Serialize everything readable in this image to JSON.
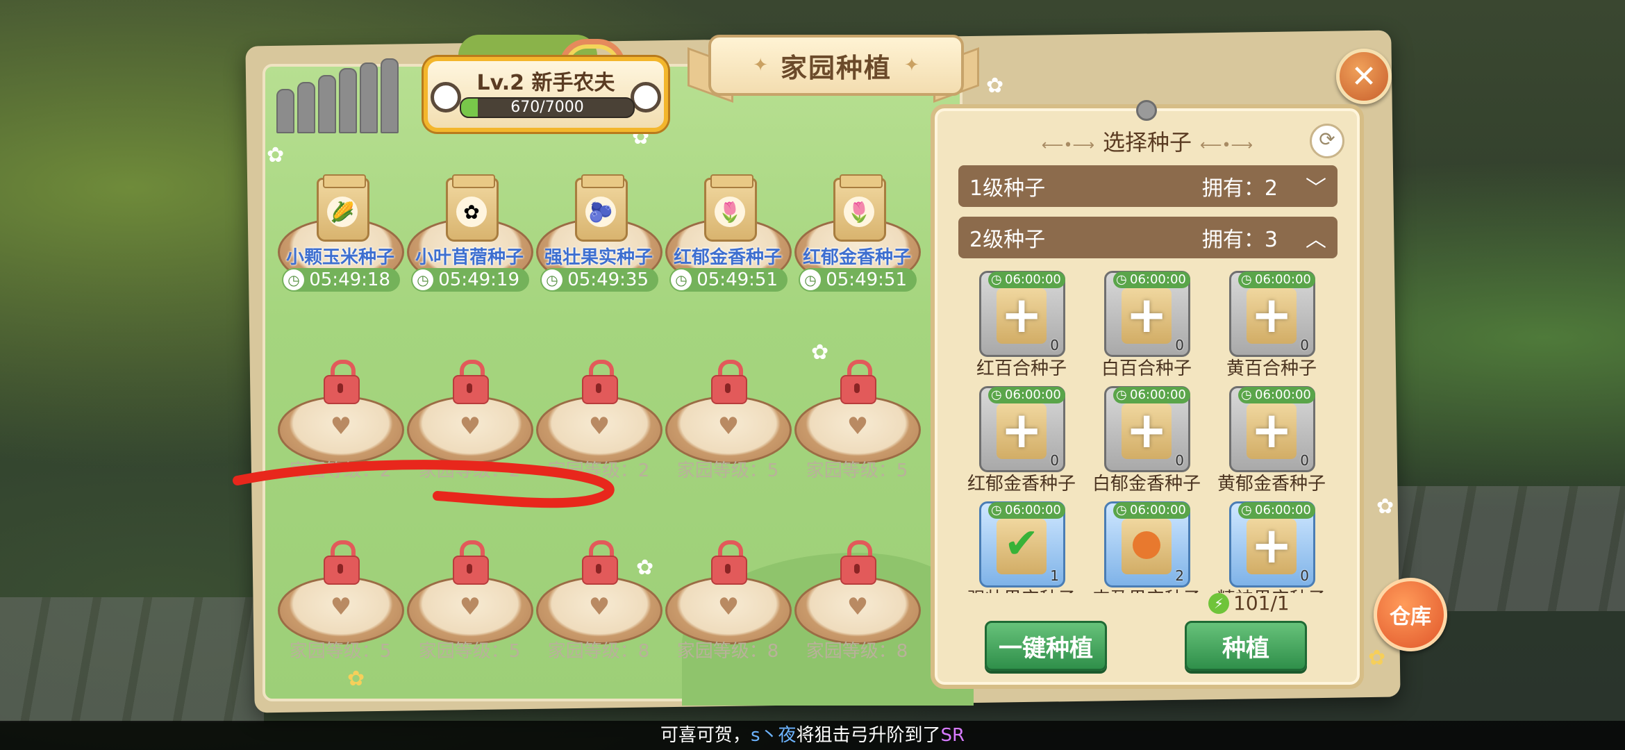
{
  "window": {
    "title": "家园种植"
  },
  "level": {
    "label": "Lv.2 新手农夫",
    "exp_text": "670/7000",
    "exp_progress": 0.0957
  },
  "planted_plots": [
    {
      "name": "小颗玉米种子",
      "timer": "05:49:18",
      "icon": "🌽"
    },
    {
      "name": "小叶苜蓿种子",
      "timer": "05:49:19",
      "icon": "✿"
    },
    {
      "name": "强壮果实种子",
      "timer": "05:49:35",
      "icon": "🫐"
    },
    {
      "name": "红郁金香种子",
      "timer": "05:49:51",
      "icon": "🌷"
    },
    {
      "name": "红郁金香种子",
      "timer": "05:49:51",
      "icon": "🌷"
    }
  ],
  "locked_row1": [
    {
      "req": "家园等级：2"
    },
    {
      "req": "家园等级：2"
    },
    {
      "req": "家园等级：2"
    },
    {
      "req": "家园等级：5"
    },
    {
      "req": "家园等级：5"
    }
  ],
  "locked_row2": [
    {
      "req": "家园等级：5"
    },
    {
      "req": "家园等级：5"
    },
    {
      "req": "家园等级：8"
    },
    {
      "req": "家园等级：8"
    },
    {
      "req": "家园等级：8"
    }
  ],
  "seed_panel": {
    "title": "选择种子",
    "categories": [
      {
        "label": "1级种子",
        "owned": "拥有：2",
        "chevron": "﹀"
      },
      {
        "label": "2级种子",
        "owned": "拥有：3",
        "chevron": "︿"
      }
    ],
    "seeds": [
      {
        "name": "红百合种子",
        "time": "06:00:00",
        "count": "0",
        "state": "add",
        "style": "gray"
      },
      {
        "name": "白百合种子",
        "time": "06:00:00",
        "count": "0",
        "state": "add",
        "style": "gray"
      },
      {
        "name": "黄百合种子",
        "time": "06:00:00",
        "count": "0",
        "state": "add",
        "style": "gray"
      },
      {
        "name": "红郁金香种子",
        "time": "06:00:00",
        "count": "0",
        "state": "add",
        "style": "gray"
      },
      {
        "name": "白郁金香种子",
        "time": "06:00:00",
        "count": "0",
        "state": "add",
        "style": "gray"
      },
      {
        "name": "黄郁金香种子",
        "time": "06:00:00",
        "count": "0",
        "state": "add",
        "style": "gray"
      },
      {
        "name": "强壮果实种子",
        "time": "06:00:00",
        "count": "1",
        "state": "selected",
        "style": "blue"
      },
      {
        "name": "丰盈果实种子",
        "time": "06:00:00",
        "count": "2",
        "state": "item",
        "style": "blue"
      },
      {
        "name": "精神果实种子",
        "time": "06:00:00",
        "count": "0",
        "state": "add",
        "style": "blue"
      }
    ],
    "energy": "101/1",
    "one_click_label": "一键种植",
    "plant_label": "种植"
  },
  "warehouse_label": "仓库",
  "close_icon": "✕",
  "notice": {
    "prefix": "可喜可贺，",
    "user": "s丶夜",
    "middle": "将狙击弓升阶到了",
    "grade": "SR"
  }
}
